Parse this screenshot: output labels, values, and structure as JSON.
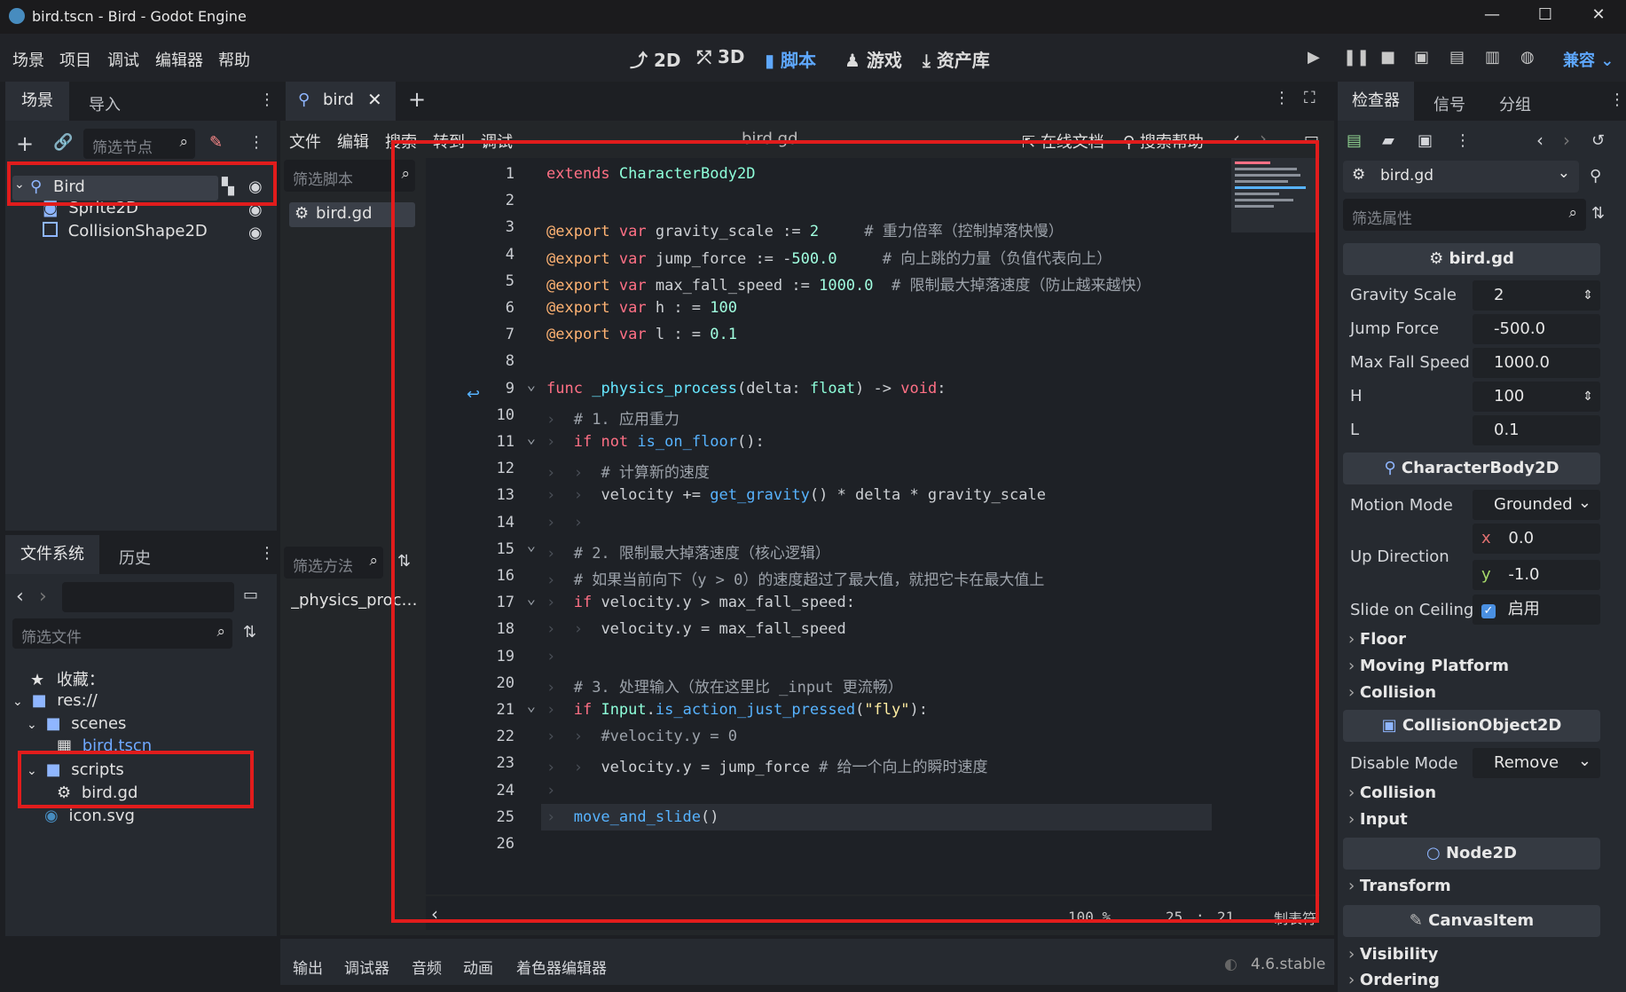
{
  "window": {
    "title": "bird.tscn - Bird - Godot Engine",
    "controls": [
      "—",
      "☐",
      "✕"
    ]
  },
  "menu": [
    "场景",
    "项目",
    "调试",
    "编辑器",
    "帮助"
  ],
  "workspaces": [
    "2D",
    "3D",
    "脚本",
    "游戏",
    "资产库"
  ],
  "active_workspace": "脚本",
  "renderer": "兼容",
  "scene_dock": {
    "tabs": [
      "场景",
      "导入"
    ],
    "filter_placeholder": "筛选节点",
    "nodes": [
      {
        "name": "Bird",
        "icon": "characterbody-icon"
      },
      {
        "name": "Sprite2D",
        "icon": "sprite-icon"
      },
      {
        "name": "CollisionShape2D",
        "icon": "collision-icon"
      }
    ]
  },
  "filesystem_dock": {
    "tabs": [
      "文件系统",
      "历史"
    ],
    "filter_placeholder": "筛选文件",
    "items": [
      {
        "label": "收藏：",
        "icon": "star-icon"
      },
      {
        "label": "res://",
        "icon": "folder-icon"
      },
      {
        "label": "scenes",
        "icon": "folder-icon"
      },
      {
        "label": "bird.tscn",
        "icon": "scene-icon"
      },
      {
        "label": "scripts",
        "icon": "folder-icon"
      },
      {
        "label": "bird.gd",
        "icon": "gear-icon"
      },
      {
        "label": "icon.svg",
        "icon": "godot-icon"
      }
    ]
  },
  "script_editor": {
    "tab": "bird",
    "menu": [
      "文件",
      "编辑",
      "搜索",
      "转到",
      "调试"
    ],
    "file_title": "bird.gd",
    "online_docs": "在线文档",
    "search_help": "搜索帮助",
    "filter_scripts_placeholder": "筛选脚本",
    "scripts": [
      "bird.gd"
    ],
    "filter_methods_placeholder": "筛选方法",
    "methods": [
      "_physics_process"
    ],
    "zoom": "100 %",
    "cursor_line": "25",
    "cursor_col": "21",
    "indent_mode": "制表符",
    "code_lines": [
      "extends CharacterBody2D",
      "",
      "@export var gravity_scale := 2     # 重力倍率（控制掉落快慢）",
      "@export var jump_force := -500.0     # 向上跳的力量（负值代表向上）",
      "@export var max_fall_speed := 1000.0  # 限制最大掉落速度（防止越来越快）",
      "@export var h : = 100",
      "@export var l : = 0.1",
      "",
      "func _physics_process(delta: float) -> void:",
      "\t# 1. 应用重力",
      "\tif not is_on_floor():",
      "\t\t# 计算新的速度",
      "\t\tvelocity += get_gravity() * delta * gravity_scale",
      "\t\t",
      "\t# 2. 限制最大掉落速度（核心逻辑）",
      "\t# 如果当前向下（y > 0）的速度超过了最大值，就把它卡在最大值上",
      "\tif velocity.y > max_fall_speed:",
      "\t\tvelocity.y = max_fall_speed",
      "\t",
      "\t# 3. 处理输入（放在这里比 _input 更流畅）",
      "\tif Input.is_action_just_pressed(\"fly\"):",
      "\t\t#velocity.y = 0",
      "\t\tvelocity.y = jump_force # 给一个向上的瞬时速度",
      "\t",
      "\tmove_and_slide()",
      ""
    ]
  },
  "bottom_panel": {
    "tabs": [
      "输出",
      "调试器",
      "音频",
      "动画",
      "着色器编辑器"
    ],
    "version": "4.6.stable"
  },
  "inspector": {
    "tabs": [
      "检查器",
      "信号",
      "分组"
    ],
    "resource": "bird.gd",
    "filter_placeholder": "筛选属性",
    "script_section": "bird.gd",
    "script_props": [
      {
        "label": "Gravity Scale",
        "value": "2"
      },
      {
        "label": "Jump Force",
        "value": "-500.0"
      },
      {
        "label": "Max Fall Speed",
        "value": "1000.0"
      },
      {
        "label": "H",
        "value": "100"
      },
      {
        "label": "L",
        "value": "0.1"
      }
    ],
    "characterbody_section": "CharacterBody2D",
    "motion_mode": {
      "label": "Motion Mode",
      "value": "Grounded"
    },
    "up_direction": {
      "label": "Up Direction",
      "x": "0.0",
      "y": "-1.0"
    },
    "slide_on_ceiling": {
      "label": "Slide on Ceiling",
      "value": "启用",
      "checked": true
    },
    "cb_groups": [
      "Floor",
      "Moving Platform",
      "Collision"
    ],
    "collisionobject_section": "CollisionObject2D",
    "disable_mode": {
      "label": "Disable Mode",
      "value": "Remove"
    },
    "co_groups": [
      "Collision",
      "Input"
    ],
    "node2d_section": "Node2D",
    "node2d_groups": [
      "Transform"
    ],
    "canvasitem_section": "CanvasItem",
    "ci_groups": [
      "Visibility",
      "Ordering"
    ]
  },
  "colors": {
    "accent": "#5ea8ff",
    "highlight_box": "#e11c1c",
    "background": "#1d1f23"
  }
}
